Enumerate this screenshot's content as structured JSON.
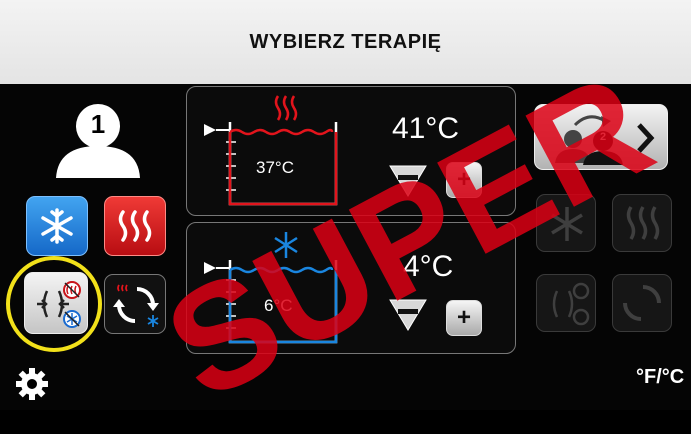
{
  "header": {
    "title": "WYBIERZ TERAPIĘ"
  },
  "patient": {
    "number": "1",
    "next_patient_number": "2"
  },
  "tank_hot": {
    "temp": "37°C",
    "setpoint": "41°C"
  },
  "tank_cold": {
    "temp": "6°C",
    "setpoint": "4°C"
  },
  "units": {
    "label": "°F/°C"
  },
  "colors": {
    "hot": "#e3141c",
    "cold": "#1a86e0",
    "highlight": "#f2e11a"
  },
  "watermark": "SUPER"
}
